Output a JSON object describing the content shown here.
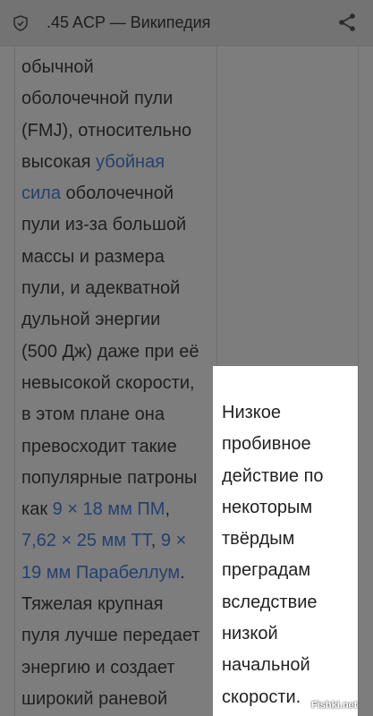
{
  "header": {
    "title": ".45 ACP — Википедия",
    "left_icon": "shield-icon",
    "right_icon": "share-icon"
  },
  "article": {
    "lines": [
      [
        {
          "t": "обычной"
        }
      ],
      [
        {
          "t": "оболочечной пули"
        }
      ],
      [
        {
          "t": "(FMJ), относительно"
        }
      ],
      [
        {
          "t": "высокая "
        },
        {
          "t": "убойная",
          "link": true
        }
      ],
      [
        {
          "t": "сила",
          "link": true
        },
        {
          "t": " оболочечной"
        }
      ],
      [
        {
          "t": "пули из-за большой"
        }
      ],
      [
        {
          "t": "массы и размера"
        }
      ],
      [
        {
          "t": "пули, и адекватной"
        }
      ],
      [
        {
          "t": "дульной энергии"
        }
      ],
      [
        {
          "t": "(500 Дж) даже при её"
        }
      ],
      [
        {
          "t": "невысокой скорости,"
        }
      ],
      [
        {
          "t": "в этом плане она"
        }
      ],
      [
        {
          "t": "превосходит такие"
        }
      ],
      [
        {
          "t": "популярные патроны"
        }
      ],
      [
        {
          "t": "как "
        },
        {
          "t": "9 × 18 мм ПМ",
          "link": true
        },
        {
          "t": ","
        }
      ],
      [
        {
          "t": "7,62 × 25 мм ТТ",
          "link": true
        },
        {
          "t": ", "
        },
        {
          "t": "9 ×",
          "link": true
        }
      ],
      [
        {
          "t": "19 мм Парабеллум",
          "link": true
        },
        {
          "t": "."
        }
      ],
      [
        {
          "t": "Тяжелая крупная"
        }
      ],
      [
        {
          "t": "пуля лучше передает"
        }
      ],
      [
        {
          "t": "энергию и создает"
        }
      ],
      [
        {
          "t": "широкий раневой"
        }
      ]
    ]
  },
  "popup": {
    "lines": [
      "Низкое",
      "пробивное",
      "действие по",
      "некоторым",
      "твёрдым",
      "преградам",
      "вследствие",
      "низкой",
      "начальной",
      "скорости."
    ]
  },
  "watermark": "Fishki.net",
  "colors": {
    "link": "#24406e",
    "dim_bg": "#7d7d7d",
    "popup_bg": "#ffffff"
  }
}
